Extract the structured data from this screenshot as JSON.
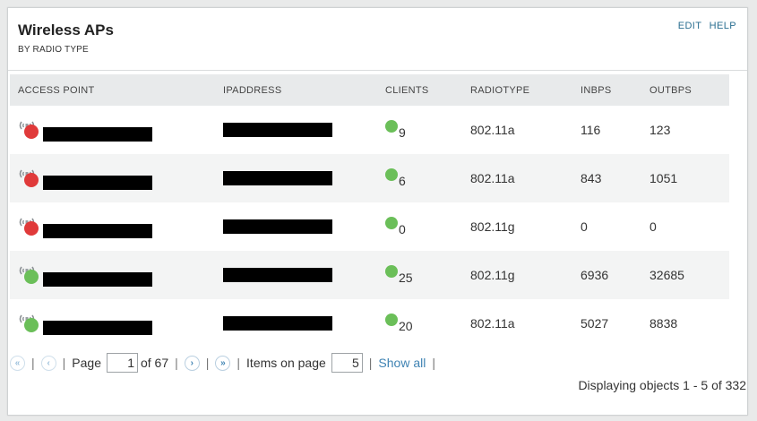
{
  "widget": {
    "title": "Wireless APs",
    "subtitle": "BY RADIO TYPE",
    "edit_label": "EDIT",
    "help_label": "HELP"
  },
  "table": {
    "columns": [
      "ACCESS POINT",
      "IPADDRESS",
      "CLIENTS",
      "RADIOTYPE",
      "INBPS",
      "OUTBPS"
    ],
    "rows": [
      {
        "status": "down",
        "status_color": "#e03a3a",
        "clients": "9",
        "radiotype": "802.11a",
        "inbps": "116",
        "outbps": "123"
      },
      {
        "status": "down",
        "status_color": "#e03a3a",
        "clients": "6",
        "radiotype": "802.11a",
        "inbps": "843",
        "outbps": "1051"
      },
      {
        "status": "down",
        "status_color": "#e03a3a",
        "clients": "0",
        "radiotype": "802.11g",
        "inbps": "0",
        "outbps": "0"
      },
      {
        "status": "up",
        "status_color": "#6bbf59",
        "clients": "25",
        "radiotype": "802.11g",
        "inbps": "6936",
        "outbps": "32685"
      },
      {
        "status": "up",
        "status_color": "#6bbf59",
        "clients": "20",
        "radiotype": "802.11a",
        "inbps": "5027",
        "outbps": "8838"
      }
    ]
  },
  "pager": {
    "page_label": "Page",
    "current_page": "1",
    "of_label": "of 67",
    "items_label": "Items on page",
    "items_per_page": "5",
    "show_all_label": "Show all",
    "separator": "|"
  },
  "footer": {
    "displaying": "Displaying objects 1 - 5 of 332"
  },
  "colors": {
    "link": "#3f83b3",
    "client_dot": "#6bbf59",
    "down": "#e03a3a",
    "up": "#6bbf59"
  }
}
